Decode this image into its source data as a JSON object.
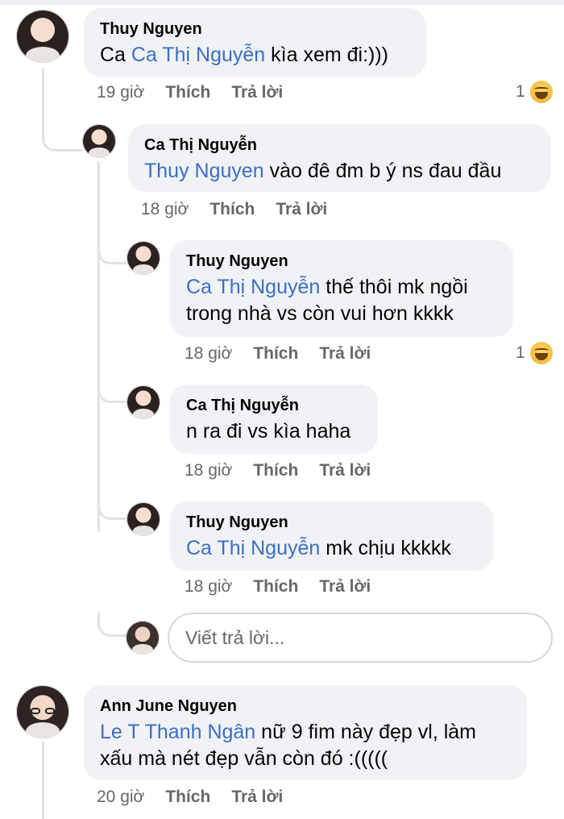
{
  "comments": [
    {
      "author": "Thuy Nguyen",
      "text_prefix": "Ca ",
      "mention": "Ca Thị Nguyễn",
      "text_suffix": " kìa xem đi:)))",
      "time": "19 giờ",
      "like_label": "Thích",
      "reply_label": "Trả lời",
      "reaction_count": "1",
      "reaction_icon": "haha-emoji-icon"
    },
    {
      "author": "Ca Thị Nguyễn",
      "mention": "Thuy Nguyen",
      "text_suffix": " vào đê đm b ý ns đau đầu",
      "time": "18 giờ",
      "like_label": "Thích",
      "reply_label": "Trả lời"
    },
    {
      "author": "Thuy Nguyen",
      "mention": "Ca Thị Nguyễn",
      "text_suffix": " thế thôi mk ngồi",
      "text_line2": "trong nhà vs còn vui hơn kkkk",
      "time": "18 giờ",
      "like_label": "Thích",
      "reply_label": "Trả lời",
      "reaction_count": "1",
      "reaction_icon": "haha-emoji-icon"
    },
    {
      "author": "Ca Thị Nguyễn",
      "text": "n ra đi vs kìa haha",
      "time": "18 giờ",
      "like_label": "Thích",
      "reply_label": "Trả lời"
    },
    {
      "author": "Thuy Nguyen",
      "mention": "Ca Thị Nguyễn",
      "text_suffix": " mk chịu kkkkk",
      "time": "18 giờ",
      "like_label": "Thích",
      "reply_label": "Trả lời"
    },
    {
      "author": "Ann June Nguyen",
      "mention": "Le T Thanh Ngân",
      "text_suffix": " nữ 9 fim này đẹp vl, làm",
      "text_line2": "xấu mà nét đẹp vẫn còn đó :(((((",
      "time": "20 giờ",
      "like_label": "Thích",
      "reply_label": "Trả lời"
    }
  ],
  "reply_box": {
    "placeholder": "Viết trả lời..."
  },
  "colors": {
    "mention": "#3a6fc4",
    "bubble": "#f0f2f5",
    "meta": "#65676b"
  }
}
